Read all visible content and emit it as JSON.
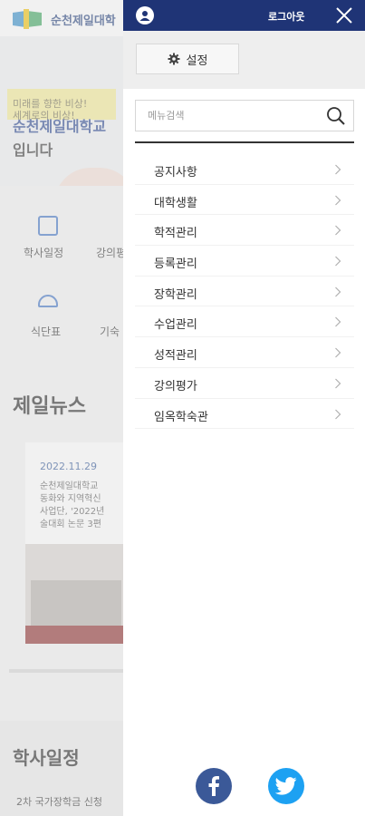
{
  "background": {
    "logo_text": "순천제일대학",
    "hero_subtitle_1": "미래를 향한 비상!",
    "hero_subtitle_2": "세계로의 비상!",
    "hero_title_1": "순천제일대학교",
    "hero_title_2": "입니다",
    "quick_links": [
      {
        "label": "학사일정",
        "icon": "calendar-icon"
      },
      {
        "label": "강의평",
        "icon": "lecture-icon"
      },
      {
        "label": "식단표",
        "icon": "meal-icon"
      },
      {
        "label": "기숙",
        "icon": "dorm-icon"
      }
    ],
    "news_title": "제일뉴스",
    "news_date": "2022.11.29",
    "news_lines": [
      "순천제일대학교 ",
      "동화와 지역혁신",
      "사업단, '2022년",
      "술대회 논문 3편"
    ],
    "schedule_title": "학사일정",
    "schedule_item": "2차 국가장학금 신청"
  },
  "drawer": {
    "logout_label": "로그아웃",
    "settings_label": "설정",
    "search_placeholder": "메뉴검색",
    "menu_items": [
      {
        "label": "공지사항"
      },
      {
        "label": "대학생활"
      },
      {
        "label": "학적관리"
      },
      {
        "label": "등록관리"
      },
      {
        "label": "장학관리"
      },
      {
        "label": "수업관리"
      },
      {
        "label": "성적관리"
      },
      {
        "label": "강의평가"
      },
      {
        "label": "임옥학숙관"
      }
    ]
  },
  "social": {
    "facebook_icon": "facebook-icon",
    "twitter_icon": "twitter-icon"
  },
  "colors": {
    "header": "#1f3476",
    "facebook": "#3b5998",
    "twitter": "#1da1f2"
  }
}
